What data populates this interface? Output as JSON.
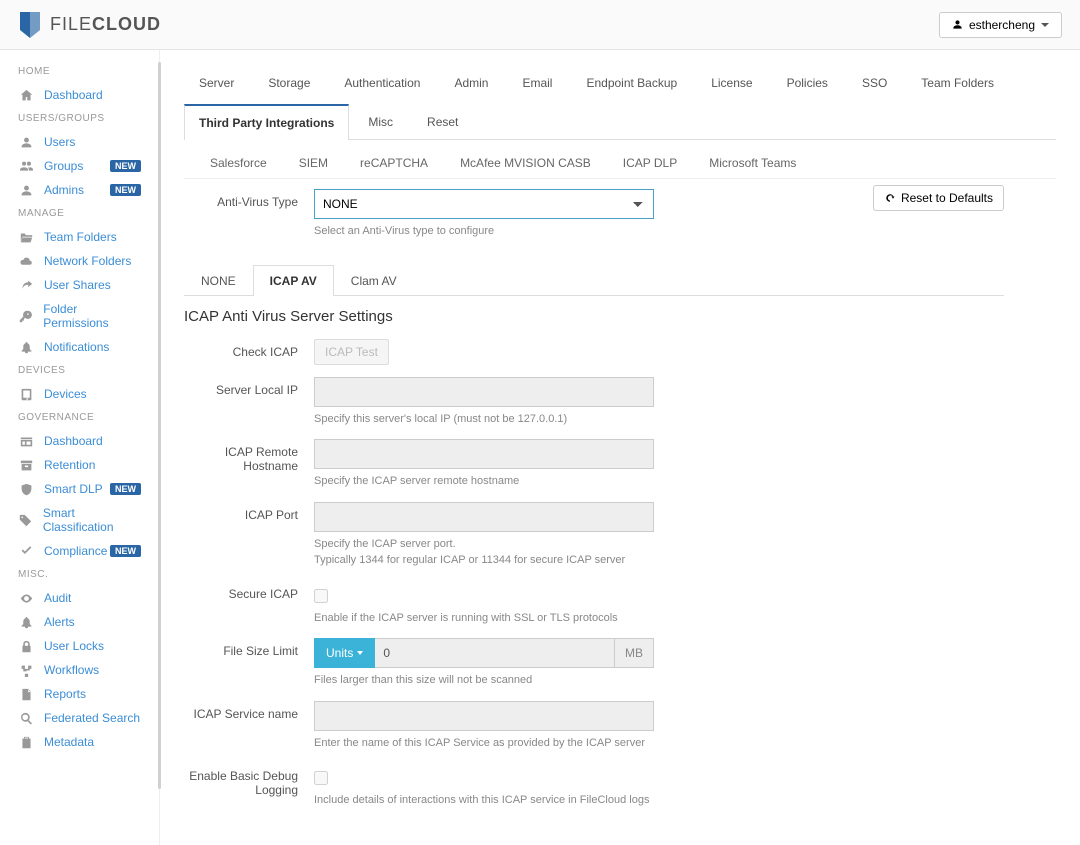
{
  "brand": {
    "name_light": "FILE",
    "name_bold": "CLOUD"
  },
  "user": {
    "name": "esthercheng"
  },
  "sidebar": {
    "sections": [
      {
        "header": "HOME",
        "items": [
          {
            "icon": "home",
            "label": "Dashboard"
          }
        ]
      },
      {
        "header": "USERS/GROUPS",
        "items": [
          {
            "icon": "user",
            "label": "Users"
          },
          {
            "icon": "users",
            "label": "Groups",
            "badge": "NEW"
          },
          {
            "icon": "user",
            "label": "Admins",
            "badge": "NEW"
          }
        ]
      },
      {
        "header": "MANAGE",
        "items": [
          {
            "icon": "folder-open",
            "label": "Team Folders"
          },
          {
            "icon": "cloud",
            "label": "Network Folders"
          },
          {
            "icon": "share",
            "label": "User Shares"
          },
          {
            "icon": "key",
            "label": "Folder Permissions"
          },
          {
            "icon": "bell",
            "label": "Notifications"
          }
        ]
      },
      {
        "header": "DEVICES",
        "items": [
          {
            "icon": "tablet",
            "label": "Devices"
          }
        ]
      },
      {
        "header": "GOVERNANCE",
        "items": [
          {
            "icon": "columns",
            "label": "Dashboard"
          },
          {
            "icon": "archive",
            "label": "Retention"
          },
          {
            "icon": "shield",
            "label": "Smart DLP",
            "badge": "NEW"
          },
          {
            "icon": "tag",
            "label": "Smart Classification"
          },
          {
            "icon": "check",
            "label": "Compliance",
            "badge": "NEW"
          }
        ]
      },
      {
        "header": "MISC.",
        "items": [
          {
            "icon": "eye",
            "label": "Audit"
          },
          {
            "icon": "bell",
            "label": "Alerts"
          },
          {
            "icon": "lock",
            "label": "User Locks"
          },
          {
            "icon": "flow",
            "label": "Workflows"
          },
          {
            "icon": "file",
            "label": "Reports"
          },
          {
            "icon": "search",
            "label": "Federated Search"
          },
          {
            "icon": "clipboard",
            "label": "Metadata"
          }
        ]
      }
    ]
  },
  "tabs": {
    "primary": [
      "Server",
      "Storage",
      "Authentication",
      "Admin",
      "Email",
      "Endpoint Backup",
      "License",
      "Policies",
      "SSO",
      "Team Folders",
      "Third Party Integrations",
      "Misc",
      "Reset"
    ],
    "active_primary": "Third Party Integrations",
    "secondary": [
      "Salesforce",
      "SIEM",
      "reCAPTCHA",
      "McAfee MVISION CASB",
      "ICAP DLP",
      "Microsoft Teams"
    ]
  },
  "form": {
    "av_type": {
      "label": "Anti-Virus Type",
      "value": "NONE",
      "help": "Select an Anti-Virus type to configure"
    },
    "reset_btn": "Reset to Defaults",
    "inner_tabs": [
      "NONE",
      "ICAP AV",
      "Clam AV"
    ],
    "inner_active": "ICAP AV",
    "section_title": "ICAP Anti Virus Server Settings",
    "fields": {
      "check_icap": {
        "label": "Check ICAP",
        "button": "ICAP Test"
      },
      "server_ip": {
        "label": "Server Local IP",
        "help": "Specify this server's local IP (must not be 127.0.0.1)"
      },
      "icap_host": {
        "label": "ICAP Remote Hostname",
        "help": "Specify the ICAP server remote hostname"
      },
      "icap_port": {
        "label": "ICAP Port",
        "help": "Specify the ICAP server port.\nTypically 1344 for regular ICAP or 11344 for secure ICAP server"
      },
      "secure": {
        "label": "Secure ICAP",
        "help": "Enable if the ICAP server is running with SSL or TLS protocols"
      },
      "file_size": {
        "label": "File Size Limit",
        "units_label": "Units",
        "value": "0",
        "suffix": "MB",
        "help": "Files larger than this size will not be scanned"
      },
      "service_name": {
        "label": "ICAP Service name",
        "help": "Enter the name of this ICAP Service as provided by the ICAP server"
      },
      "debug": {
        "label": "Enable Basic Debug Logging",
        "help": "Include details of interactions with this ICAP service in FileCloud logs"
      }
    }
  }
}
